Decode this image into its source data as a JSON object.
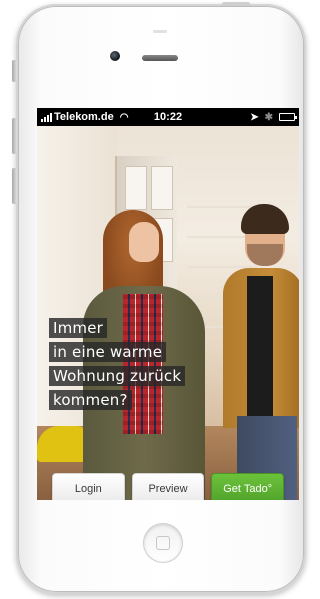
{
  "status_bar": {
    "carrier": "Telekom.de",
    "time": "10:22",
    "icons": [
      "signal-icon",
      "wifi-icon",
      "location-arrow-icon",
      "bluetooth-icon",
      "battery-icon"
    ]
  },
  "hero": {
    "headline_lines": [
      "Immer",
      "in eine warme",
      "Wohnung zurück",
      "kommen?"
    ]
  },
  "buttons": {
    "login": "Login",
    "preview": "Preview",
    "get_tado": "Get Tado°"
  },
  "colors": {
    "primary_green": "#5cb030",
    "caption_bg": "#282828"
  }
}
